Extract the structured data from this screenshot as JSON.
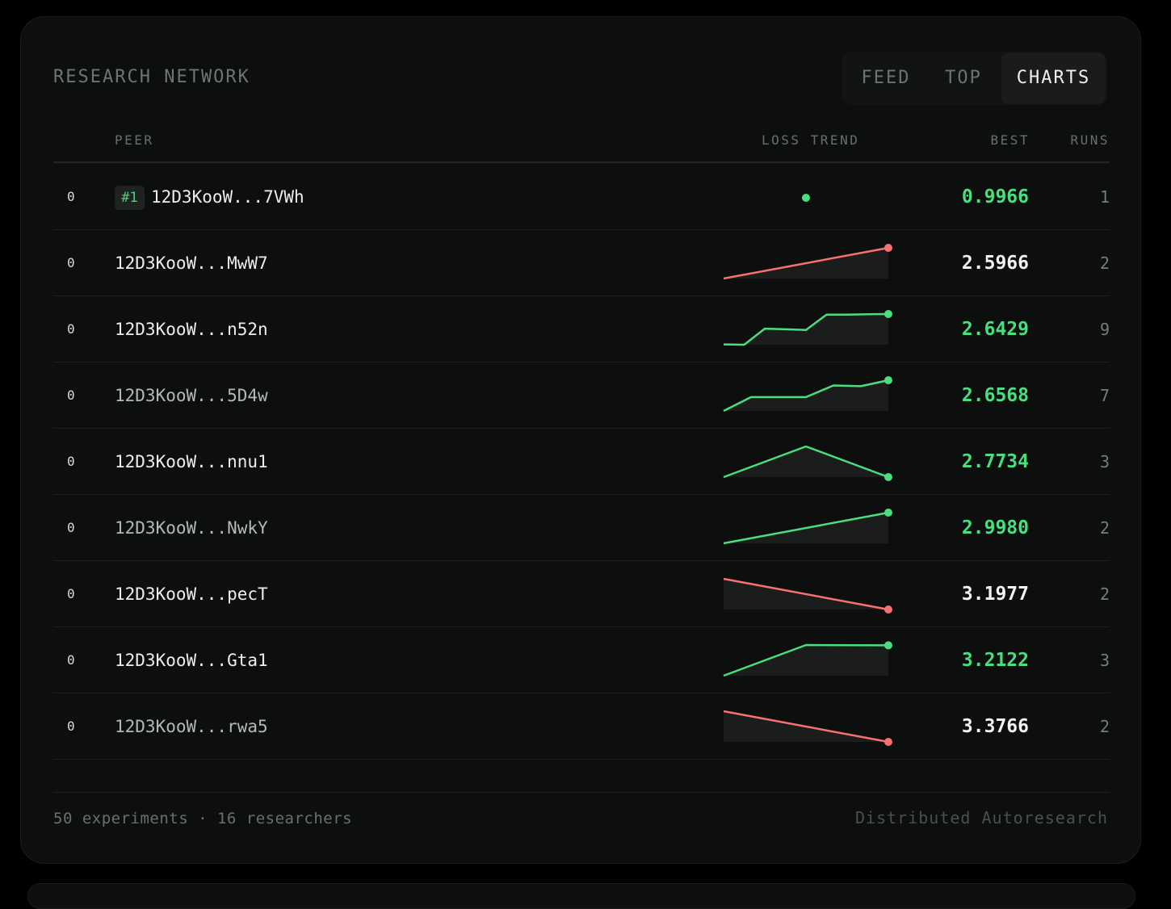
{
  "header": {
    "title": "RESEARCH NETWORK",
    "tabs": [
      {
        "label": "FEED",
        "active": false
      },
      {
        "label": "TOP",
        "active": false
      },
      {
        "label": "CHARTS",
        "active": true
      }
    ]
  },
  "table": {
    "columns": {
      "peer": "PEER",
      "trend": "LOSS TREND",
      "best": "BEST",
      "runs": "RUNS"
    },
    "rows": [
      {
        "rank": "0",
        "badge": "#1",
        "peer": "12D3KooW...7VWh",
        "best": "0.9966",
        "runs": "1",
        "trend": [
          0.9966
        ],
        "improving": true,
        "dim": false
      },
      {
        "rank": "0",
        "badge": "",
        "peer": "12D3KooW...MwW7",
        "best": "2.5966",
        "runs": "2",
        "trend": [
          3.4,
          2.5966
        ],
        "improving": false,
        "dim": false
      },
      {
        "rank": "0",
        "badge": "",
        "peer": "12D3KooW...n52n",
        "best": "2.6429",
        "runs": "9",
        "trend": [
          3.55,
          3.56,
          3.08,
          3.1,
          3.12,
          2.66,
          2.66,
          2.65,
          2.6429
        ],
        "improving": true,
        "dim": false
      },
      {
        "rank": "0",
        "badge": "",
        "peer": "12D3KooW...5D4w",
        "best": "2.6568",
        "runs": "7",
        "trend": [
          3.5,
          3.12,
          3.12,
          3.12,
          2.8,
          2.82,
          2.6568
        ],
        "improving": true,
        "dim": true
      },
      {
        "rank": "0",
        "badge": "",
        "peer": "12D3KooW...nnu1",
        "best": "2.7734",
        "runs": "3",
        "trend": [
          3.5,
          2.77,
          3.5
        ],
        "improving": true,
        "dim": false
      },
      {
        "rank": "0",
        "badge": "",
        "peer": "12D3KooW...NwkY",
        "best": "2.9980",
        "runs": "2",
        "trend": [
          3.8,
          2.998
        ],
        "improving": true,
        "dim": true
      },
      {
        "rank": "0",
        "badge": "",
        "peer": "12D3KooW...pecT",
        "best": "3.1977",
        "runs": "2",
        "trend": [
          3.1977,
          4.0
        ],
        "improving": false,
        "dim": false
      },
      {
        "rank": "0",
        "badge": "",
        "peer": "12D3KooW...Gta1",
        "best": "3.2122",
        "runs": "3",
        "trend": [
          4.0,
          3.2122,
          3.22
        ],
        "improving": true,
        "dim": false
      },
      {
        "rank": "0",
        "badge": "",
        "peer": "12D3KooW...rwa5",
        "best": "3.3766",
        "runs": "2",
        "trend": [
          3.3766,
          4.2
        ],
        "improving": false,
        "dim": true
      }
    ]
  },
  "footer": {
    "stats": "50 experiments · 16 researchers",
    "brand": "Distributed Autoresearch"
  },
  "colors": {
    "green": "#4ade80",
    "red": "#f87171",
    "best_white": "#f1f3f2"
  }
}
